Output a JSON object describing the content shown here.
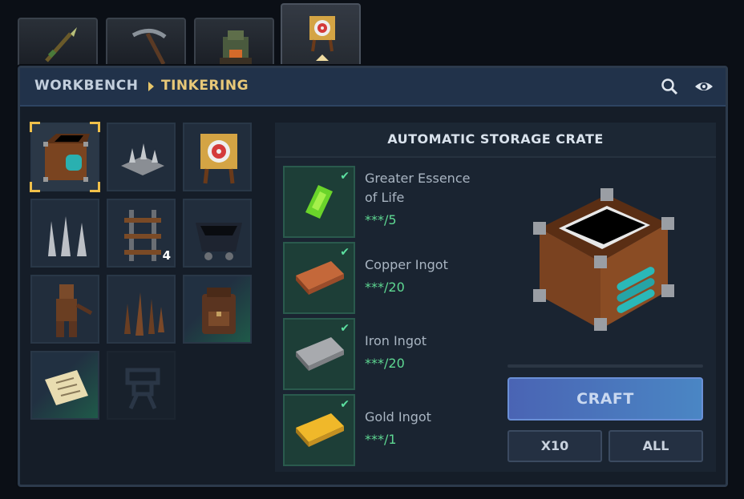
{
  "tabs": [
    {
      "icon": "spear-icon",
      "active": false
    },
    {
      "icon": "pickaxe-icon",
      "active": false
    },
    {
      "icon": "furnace-icon",
      "active": false
    },
    {
      "icon": "target-dummy-icon",
      "active": true
    }
  ],
  "breadcrumb": {
    "parent": "WORKBENCH",
    "current": "TINKERING"
  },
  "header_icons": [
    "search-icon",
    "eye-icon"
  ],
  "recipes": [
    {
      "icon": "storage-crate-icon",
      "selected": true
    },
    {
      "icon": "spike-trap-icon"
    },
    {
      "icon": "target-dummy-icon"
    },
    {
      "icon": "floor-spikes-icon"
    },
    {
      "icon": "rail-track-icon",
      "quantity": "4"
    },
    {
      "icon": "minecart-icon"
    },
    {
      "icon": "wooden-figure-icon"
    },
    {
      "icon": "wooden-stakes-icon"
    },
    {
      "icon": "backpack-icon",
      "highlight": true
    },
    {
      "icon": "scroll-icon",
      "highlight": true
    },
    {
      "icon": "locked-emblem-icon",
      "locked": true
    }
  ],
  "detail": {
    "title": "AUTOMATIC STORAGE CRATE",
    "materials": [
      {
        "name": "Greater Essence of Life",
        "amount": "***/5",
        "icon": "essence-icon"
      },
      {
        "name": "Copper Ingot",
        "amount": "***/20",
        "icon": "copper-ingot-icon"
      },
      {
        "name": "Iron Ingot",
        "amount": "***/20",
        "icon": "iron-ingot-icon"
      },
      {
        "name": "Gold Ingot",
        "amount": "***/1",
        "icon": "gold-ingot-icon"
      }
    ],
    "preview_icon": "storage-crate-icon",
    "craft_label": "CRAFT",
    "craft_x10_label": "X10",
    "craft_all_label": "ALL"
  },
  "colors": {
    "accent": "#e8c878",
    "success": "#5ed892",
    "craft": "#4a74bc"
  }
}
